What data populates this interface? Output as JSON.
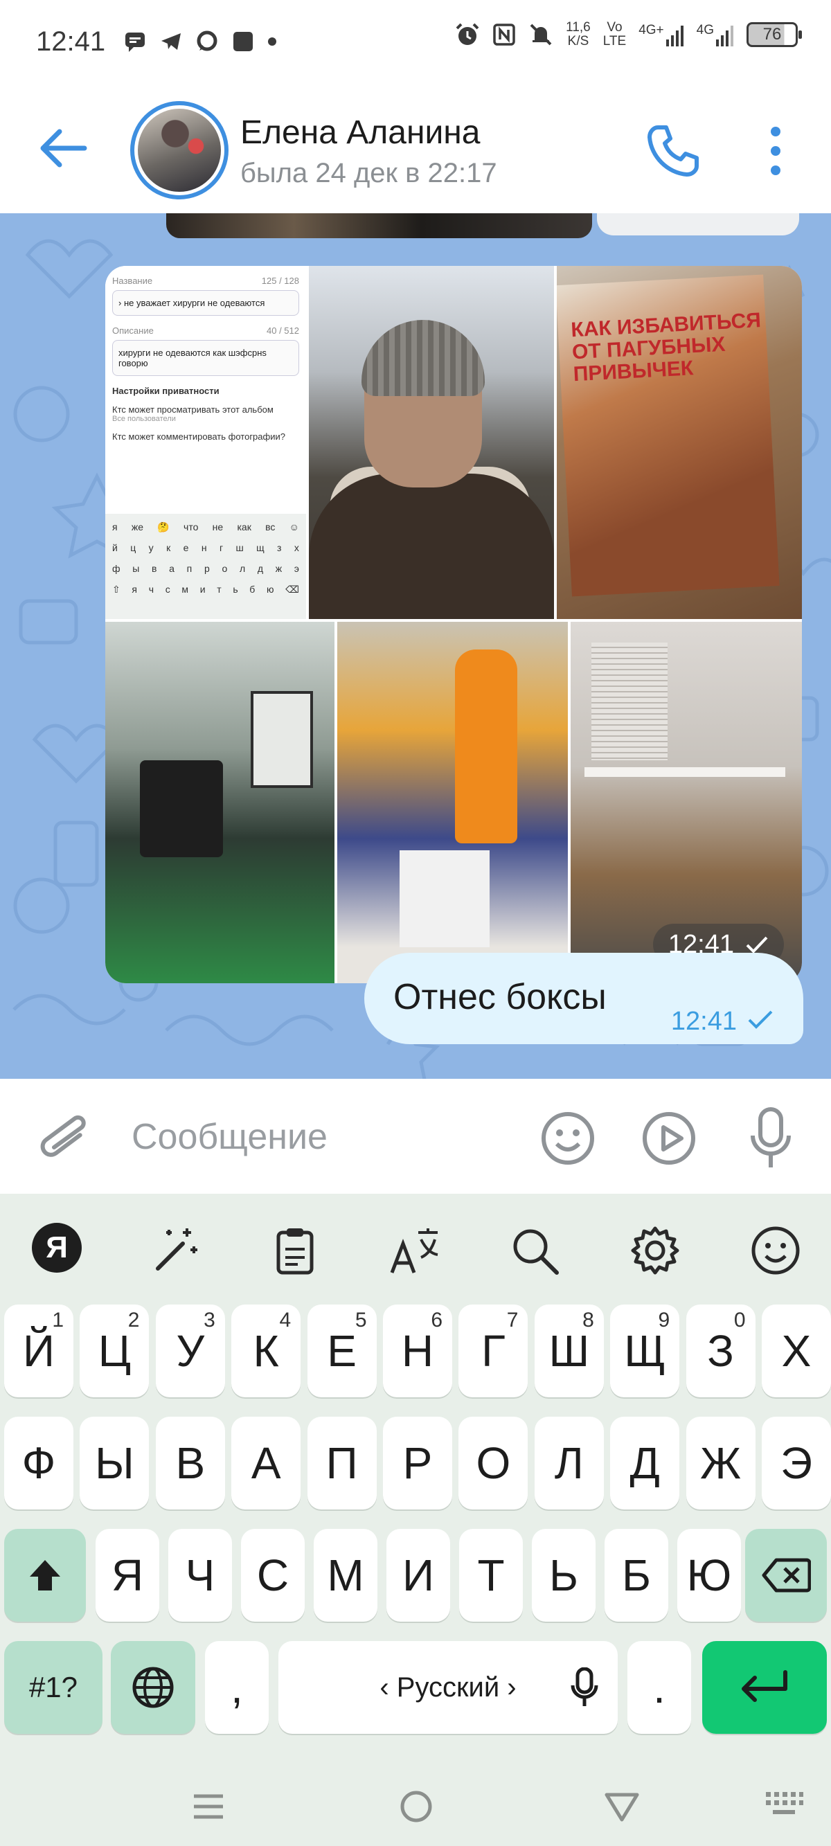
{
  "status_bar": {
    "time": "12:41",
    "net_speed_value": "11,6",
    "net_speed_unit": "K/S",
    "volte_top": "Vo",
    "volte_bottom": "LTE",
    "net_type_1": "4G+",
    "net_type_2": "4G",
    "battery": "76"
  },
  "header": {
    "contact_name": "Елена Аланина",
    "last_seen": "была 24 дек в 22:17"
  },
  "album": {
    "time": "12:41",
    "screenshot": {
      "name_label": "Название",
      "name_count": "125 / 128",
      "name_value": "› не уважает хирурги не одеваются",
      "desc_label": "Описание",
      "desc_count": "40 / 512",
      "desc_value": "хирурги не одеваются как шэфсрнs говорю",
      "privacy_title": "Настройки приватности",
      "q1": "Ктс может просматривать этот альбом",
      "q1_sub": "Все пользователи",
      "q2": "Ктс может комментировать фотографии?",
      "kb_suggest": [
        "я",
        "же",
        "🤔",
        "что",
        "не",
        "как",
        "вс",
        "☺"
      ],
      "kb_row1": [
        "й",
        "ц",
        "у",
        "к",
        "е",
        "н",
        "г",
        "ш",
        "щ",
        "з",
        "х"
      ],
      "kb_row2": [
        "ф",
        "ы",
        "в",
        "а",
        "п",
        "р",
        "о",
        "л",
        "д",
        "ж",
        "э"
      ],
      "kb_row3": [
        "⇧",
        "я",
        "ч",
        "с",
        "м",
        "и",
        "т",
        "ь",
        "б",
        "ю",
        "⌫"
      ]
    },
    "book_title": "КАК ИЗБАВИТЬСЯ ОТ ПАГУБНЫХ ПРИВЫЧЕК"
  },
  "message": {
    "text": "Отнес боксы",
    "time": "12:41"
  },
  "input": {
    "placeholder": "Сообщение"
  },
  "keyboard": {
    "brand": "Я",
    "row1": [
      {
        "label": "Й",
        "hint": "1"
      },
      {
        "label": "Ц",
        "hint": "2"
      },
      {
        "label": "У",
        "hint": "3"
      },
      {
        "label": "К",
        "hint": "4"
      },
      {
        "label": "Е",
        "hint": "5"
      },
      {
        "label": "Н",
        "hint": "6"
      },
      {
        "label": "Г",
        "hint": "7"
      },
      {
        "label": "Ш",
        "hint": "8"
      },
      {
        "label": "Щ",
        "hint": "9"
      },
      {
        "label": "З",
        "hint": "0"
      },
      {
        "label": "Х",
        "hint": ""
      }
    ],
    "row2": [
      "Ф",
      "Ы",
      "В",
      "А",
      "П",
      "Р",
      "О",
      "Л",
      "Д",
      "Ж",
      "Э"
    ],
    "row3": [
      "Я",
      "Ч",
      "С",
      "М",
      "И",
      "Т",
      "Ь",
      "Б",
      "Ю"
    ],
    "symbols_label": "#1?",
    "comma": ",",
    "space_label": "‹ Русский ›",
    "period": ".",
    "colors": {
      "accent": "#12c873",
      "modifier": "#b6dfcc",
      "bubble": "#e1f4fe",
      "chat_bg": "#8fb5e4",
      "link_blue": "#3b9de0"
    }
  }
}
